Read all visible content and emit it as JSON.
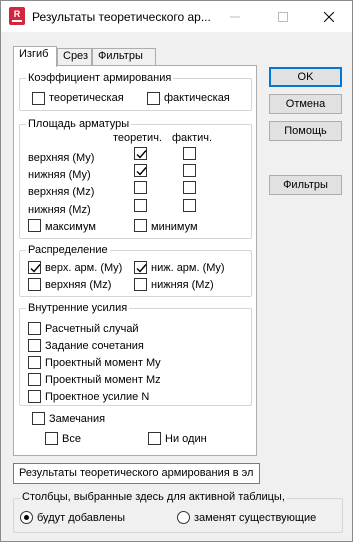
{
  "window": {
    "title": "Результаты теоретического ар...",
    "icon": "robot-app-icon",
    "controls": {
      "minimize": "minimize-icon",
      "maximize": "maximize-icon",
      "close": "close-icon"
    }
  },
  "tabs": [
    {
      "label": "Изгиб",
      "active": true
    },
    {
      "label": "Срез",
      "active": false
    },
    {
      "label": "Фильтры",
      "active": false
    }
  ],
  "reinf_coef": {
    "title": "Коэффициент армирования",
    "theoretical": {
      "label": "теоретическая",
      "checked": false
    },
    "actual": {
      "label": "фактическая",
      "checked": false
    }
  },
  "area": {
    "title": "Площадь арматуры",
    "col_theor": "теоретич.",
    "col_actual": "фактич.",
    "rows": [
      {
        "label": "верхняя (My)",
        "theor": true,
        "actual": false
      },
      {
        "label": "нижняя (My)",
        "theor": true,
        "actual": false
      },
      {
        "label": "верхняя (Mz)",
        "theor": false,
        "actual": false
      },
      {
        "label": "нижняя (Mz)",
        "theor": false,
        "actual": false
      }
    ],
    "max": {
      "label": "максимум",
      "checked": false
    },
    "min": {
      "label": "минимум",
      "checked": false
    }
  },
  "distribution": {
    "title": "Распределение",
    "top_my": {
      "label": "верх. арм. (My)",
      "checked": true
    },
    "bot_my": {
      "label": "ниж. арм. (My)",
      "checked": true
    },
    "top_mz": {
      "label": "верхняя (Mz)",
      "checked": false
    },
    "bot_mz": {
      "label": "нижняя (Mz)",
      "checked": false
    }
  },
  "forces": {
    "title": "Внутренние усилия",
    "items": [
      {
        "label": "Расчетный случай",
        "checked": false
      },
      {
        "label": "Задание сочетания",
        "checked": false
      },
      {
        "label": "Проектный момент My",
        "checked": false
      },
      {
        "label": "Проектный момент Mz",
        "checked": false
      },
      {
        "label": "Проектное  усилие N",
        "checked": false
      }
    ]
  },
  "remarks": {
    "label": "Замечания",
    "checked": false,
    "all": {
      "label": "Все",
      "checked": false
    },
    "none": {
      "label": "Ни один",
      "checked": false
    }
  },
  "buttons": {
    "ok": "OK",
    "cancel": "Отмена",
    "help": "Помощь",
    "filters": "Фильтры"
  },
  "table_name": {
    "value": "Результаты теоретического армирования в эл"
  },
  "columns": {
    "title": "Столбцы, выбранные здесь для активной таблицы,",
    "add": {
      "label": "будут добавлены",
      "selected": true
    },
    "replace": {
      "label": "заменят существующие",
      "selected": false
    }
  }
}
